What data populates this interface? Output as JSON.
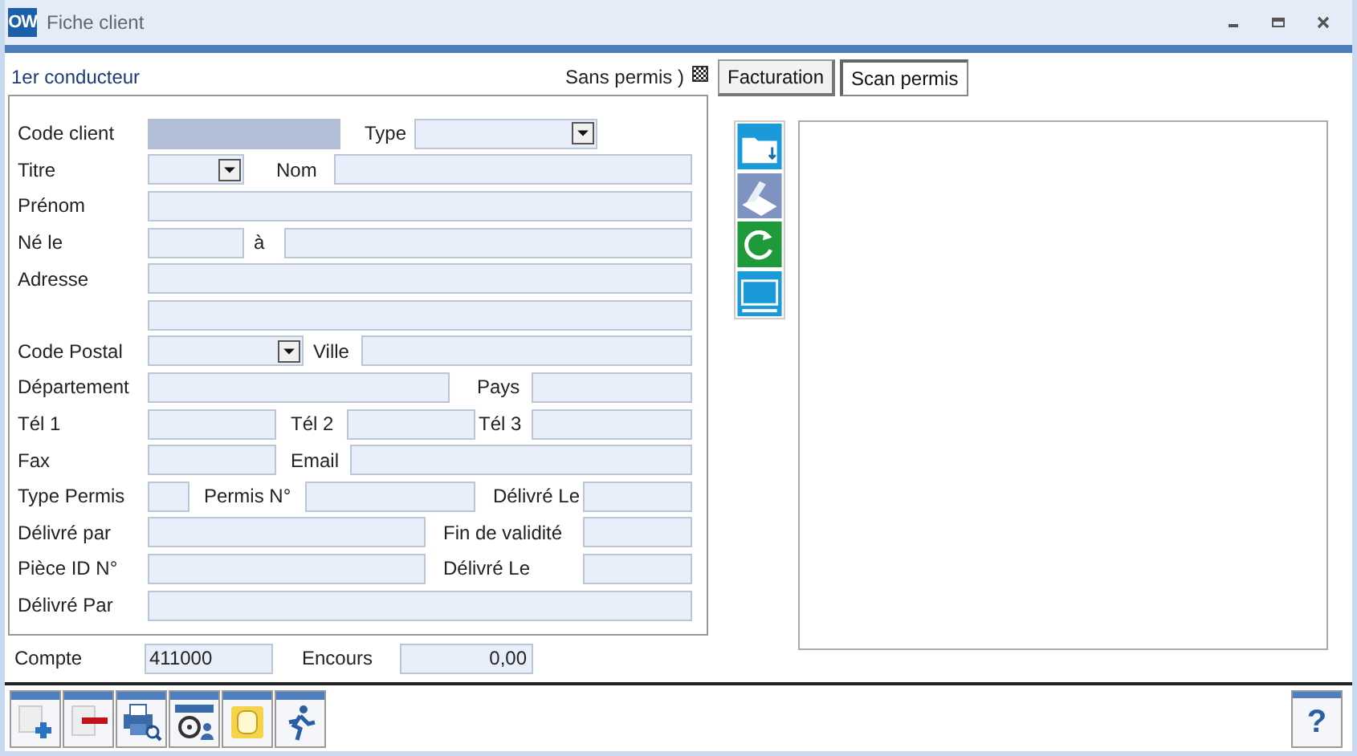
{
  "window": {
    "logo": "OW",
    "title": "Fiche client"
  },
  "section_label": "1er conducteur",
  "sans_permis": {
    "label": "Sans permis )",
    "checked": true
  },
  "tabs": [
    {
      "label": "Facturation",
      "selected": false
    },
    {
      "label": "Scan permis",
      "selected": true
    }
  ],
  "form_rows": [
    {
      "items": [
        {
          "kind": "label",
          "text": "Code client"
        },
        {
          "kind": "field",
          "focused": true
        },
        {
          "kind": "label",
          "text": "Type"
        },
        {
          "kind": "dropdown"
        }
      ]
    },
    {
      "items": [
        {
          "kind": "label",
          "text": "Titre"
        },
        {
          "kind": "dropdown"
        },
        {
          "kind": "label",
          "text": "Nom"
        },
        {
          "kind": "field",
          "focused": false
        }
      ]
    },
    {
      "items": [
        {
          "kind": "label",
          "text": "Prénom"
        },
        {
          "kind": "field",
          "focused": false
        }
      ]
    },
    {
      "items": [
        {
          "kind": "label",
          "text": "Né le"
        },
        {
          "kind": "field",
          "focused": false
        },
        {
          "kind": "label",
          "text": "à"
        },
        {
          "kind": "field",
          "focused": false
        }
      ]
    },
    {
      "items": [
        {
          "kind": "label",
          "text": "Adresse"
        },
        {
          "kind": "field",
          "focused": false
        }
      ]
    },
    {
      "items": [
        {
          "kind": "field",
          "focused": false
        }
      ]
    },
    {
      "items": [
        {
          "kind": "label",
          "text": "Code Postal"
        },
        {
          "kind": "dropdown"
        },
        {
          "kind": "label",
          "text": "Ville"
        },
        {
          "kind": "field",
          "focused": false
        }
      ]
    },
    {
      "items": [
        {
          "kind": "label",
          "text": "Département"
        },
        {
          "kind": "field",
          "focused": false
        },
        {
          "kind": "label",
          "text": "Pays"
        },
        {
          "kind": "field",
          "focused": false
        }
      ]
    },
    {
      "items": [
        {
          "kind": "label",
          "text": "Tél 1"
        },
        {
          "kind": "field",
          "focused": false
        },
        {
          "kind": "label",
          "text": "Tél 2"
        },
        {
          "kind": "field",
          "focused": false
        },
        {
          "kind": "label",
          "text": "Tél 3"
        },
        {
          "kind": "field",
          "focused": false
        }
      ]
    },
    {
      "items": [
        {
          "kind": "label",
          "text": "Fax"
        },
        {
          "kind": "field",
          "focused": false
        },
        {
          "kind": "label",
          "text": "Email"
        },
        {
          "kind": "field",
          "focused": false
        }
      ]
    },
    {
      "items": [
        {
          "kind": "label",
          "text": "Type Permis"
        },
        {
          "kind": "field",
          "focused": false
        },
        {
          "kind": "label",
          "text": "Permis N°"
        },
        {
          "kind": "field",
          "focused": false
        },
        {
          "kind": "label",
          "text": "Délivré Le"
        },
        {
          "kind": "field",
          "focused": false
        }
      ]
    },
    {
      "items": [
        {
          "kind": "label",
          "text": "Délivré par"
        },
        {
          "kind": "field",
          "focused": false
        },
        {
          "kind": "label",
          "text": "Fin de validité"
        },
        {
          "kind": "field",
          "focused": false
        }
      ]
    },
    {
      "items": [
        {
          "kind": "label",
          "text": "Pièce ID N°"
        },
        {
          "kind": "field",
          "focused": false
        },
        {
          "kind": "label",
          "text": "Délivré Le"
        },
        {
          "kind": "field",
          "focused": false
        }
      ]
    },
    {
      "items": [
        {
          "kind": "label",
          "text": "Délivré Par"
        },
        {
          "kind": "field",
          "focused": false
        }
      ]
    }
  ],
  "compte": {
    "label": "Compte",
    "value": "411000"
  },
  "encours": {
    "label": "Encours",
    "value": "0,00"
  },
  "help_button": "?"
}
